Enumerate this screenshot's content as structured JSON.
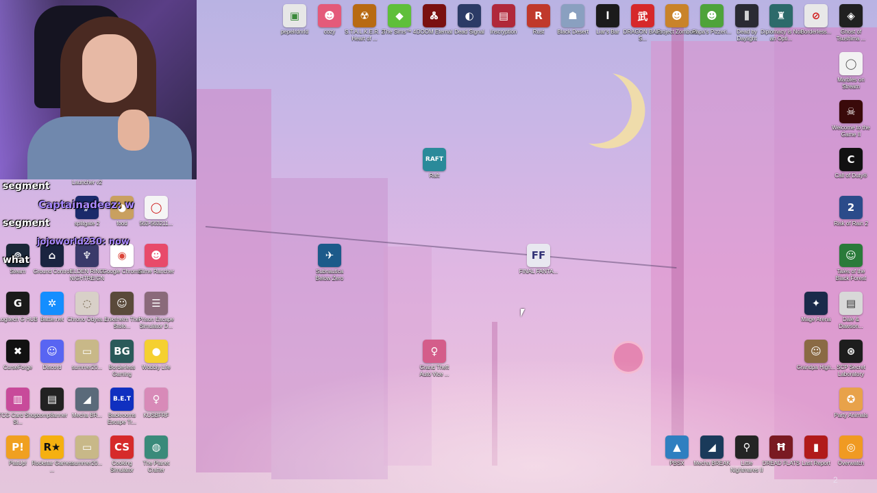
{
  "desktop": {
    "icons": [
      {
        "label": "pepelrdnrld",
        "color": "#e7e7e7",
        "glyph": "▣",
        "fg": "#3a8a3a"
      },
      {
        "label": "cozy",
        "color": "#e45a7a",
        "glyph": "☻"
      },
      {
        "label": "S.T.A.L.K.E.R. 2 Heart of ...",
        "color": "#b86a12",
        "glyph": "☢"
      },
      {
        "label": "The Sims™ 4",
        "color": "#5fbf3a",
        "glyph": "◆"
      },
      {
        "label": "DOOM Eternal",
        "color": "#7a1010",
        "glyph": "Ꮬ"
      },
      {
        "label": "Dead Signal",
        "color": "#2b3b66",
        "glyph": "◐"
      },
      {
        "label": "Inscryption",
        "color": "#b0283a",
        "glyph": "▤"
      },
      {
        "label": "Rust",
        "color": "#c0392b",
        "glyph": "R"
      },
      {
        "label": "Black Desert",
        "color": "#8aa0c0",
        "glyph": "☗"
      },
      {
        "label": "Liar's Bar",
        "color": "#1b1b1b",
        "glyph": "l"
      },
      {
        "label": "DRAGON BALL S...",
        "color": "#d6282a",
        "glyph": "武"
      },
      {
        "label": "Project Zomboid",
        "color": "#c9832a",
        "glyph": "☻"
      },
      {
        "label": "Papa's Pizzeri...",
        "color": "#4ea33a",
        "glyph": "☻"
      },
      {
        "label": "Dead by Daylight",
        "color": "#2a2a33",
        "glyph": "⫼"
      },
      {
        "label": "Diplomacy is Not an Opti...",
        "color": "#2c6a6a",
        "glyph": "♜"
      },
      {
        "label": "Borderless...",
        "color": "#e8e8e8",
        "glyph": "⊘",
        "fg": "#d01818"
      },
      {
        "label": "Ghost of Tsushima ...",
        "color": "#202020",
        "glyph": "◈"
      },
      {
        "label": "Marbles on Stream",
        "color": "#f2f2f2",
        "glyph": "◯",
        "fg": "#555555"
      },
      {
        "label": "Welcome to the Game II",
        "color": "#3a0a0a",
        "glyph": "☠"
      },
      {
        "label": "Call of Duty®",
        "color": "#111111",
        "glyph": "C"
      },
      {
        "label": "Risk of Rain 2",
        "color": "#2b4b8a",
        "glyph": "2"
      },
      {
        "label": "Tales of the Black Forest",
        "color": "#2a7a3a",
        "glyph": "☺"
      },
      {
        "label": "Mage Arena",
        "color": "#1a2a4a",
        "glyph": "✦"
      },
      {
        "label": "Dale & Dawson...",
        "color": "#d8d8d8",
        "glyph": "▤",
        "fg": "#333333"
      },
      {
        "label": "Grandpa High...",
        "color": "#8a6a44",
        "glyph": "☺"
      },
      {
        "label": "SCP Secret Laboratory",
        "color": "#1d1d1d",
        "glyph": "⊛"
      },
      {
        "label": "Party Animals",
        "color": "#e8a24a",
        "glyph": "✪"
      },
      {
        "label": "Raft",
        "color": "#2a8a9a",
        "glyph": "RAFT"
      },
      {
        "label": "Subnautica Below Zero",
        "color": "#1c5a8a",
        "glyph": "✈"
      },
      {
        "label": "FINAL FANTA...",
        "color": "#e8e8f0",
        "glyph": "FF",
        "fg": "#333377"
      },
      {
        "label": "Grand Theft Auto Vice ...",
        "color": "#d45d8a",
        "glyph": "♀"
      },
      {
        "label": "PBSX",
        "color": "#2f7fc0",
        "glyph": "▲"
      },
      {
        "label": "Mecha BREAK",
        "color": "#1a3a5a",
        "glyph": "◢"
      },
      {
        "label": "Little Nightmares II",
        "color": "#242424",
        "glyph": "⚲"
      },
      {
        "label": "DREAD FLATS",
        "color": "#7a1a22",
        "glyph": "Ħ"
      },
      {
        "label": "Last Report",
        "color": "#b11a1a",
        "glyph": "▮"
      },
      {
        "label": "Overwatch",
        "color": "#f09a22",
        "glyph": "◎"
      },
      {
        "label": "Steam",
        "color": "#1b2838",
        "glyph": "⊚"
      },
      {
        "label": "Ground Control",
        "color": "#1a2440",
        "glyph": "⌂"
      },
      {
        "label": "ELDEN RING NIGHTREIGN",
        "color": "#3a3a6a",
        "glyph": "♆"
      },
      {
        "label": "Google Chrome",
        "color": "#ffffff",
        "glyph": "◉",
        "fg": "#db4437"
      },
      {
        "label": "Slime Rancher",
        "color": "#e84a6a",
        "glyph": "☻"
      },
      {
        "label": "Logitech G HUB",
        "color": "#1a1a1a",
        "glyph": "G"
      },
      {
        "label": "Battle.net",
        "color": "#148eff",
        "glyph": "✲"
      },
      {
        "label": "Chrono Odyss...",
        "color": "#d8d0c8",
        "glyph": "◌",
        "fg": "#6a5a40"
      },
      {
        "label": "Enkshelm The Stolo...",
        "color": "#5a4a3a",
        "glyph": "☺"
      },
      {
        "label": "Prison Escape Simulator D...",
        "color": "#8a6a7a",
        "glyph": "☰"
      },
      {
        "label": "CurseForge",
        "color": "#111111",
        "glyph": "✖"
      },
      {
        "label": "Discord",
        "color": "#5865f2",
        "glyph": "☺"
      },
      {
        "label": "summer20...",
        "color": "#c8b888",
        "glyph": "▭"
      },
      {
        "label": "Borderless Gaming",
        "color": "#2a5a5a",
        "glyph": "BG"
      },
      {
        "label": "Wobbly Life",
        "color": "#f5d030",
        "glyph": "●"
      },
      {
        "label": "TCG Card Shop Si...",
        "color": "#c84a9a",
        "glyph": "▥"
      },
      {
        "label": "comp8anner",
        "color": "#222222",
        "glyph": "▤"
      },
      {
        "label": "Mecha BR...",
        "color": "#5a6a7a",
        "glyph": "◢"
      },
      {
        "label": "Backrooms Escape Tr...",
        "color": "#1030c0",
        "glyph": "B.E.T"
      },
      {
        "label": "KUSBFRF",
        "color": "#d88ab8",
        "glyph": "♀"
      },
      {
        "label": "PlatUp!",
        "color": "#f0a020",
        "glyph": "P!"
      },
      {
        "label": "Rockstar Games ...",
        "color": "#f5b010",
        "glyph": "R★",
        "fg": "#111111"
      },
      {
        "label": "summer20...",
        "color": "#c8b888",
        "glyph": "▭"
      },
      {
        "label": "Cooking Simulator",
        "color": "#d62a2a",
        "glyph": "CS"
      },
      {
        "label": "The Planet Crafter",
        "color": "#3a8a7a",
        "glyph": "◍"
      },
      {
        "label": "Launcher v2",
        "color": "#e8e8e8",
        "glyph": "▤",
        "fg": "#333333"
      },
      {
        "label": "splitgate 2",
        "color": "#1a2a6a",
        "glyph": "⫽"
      },
      {
        "label": "food",
        "color": "#c9a060",
        "glyph": "◕"
      },
      {
        "label": "563-563211...",
        "color": "#f5f5f5",
        "glyph": "◯",
        "fg": "#cc1111"
      }
    ]
  },
  "chat": {
    "lines": [
      {
        "text": "segment",
        "user": false
      },
      {
        "text": "Captainadeez: w",
        "user": true
      },
      {
        "text": "segment",
        "user": false
      },
      {
        "text": "jojoworld230: now",
        "user": true
      },
      {
        "text": "what",
        "user": false
      }
    ]
  },
  "page_counter": "2"
}
